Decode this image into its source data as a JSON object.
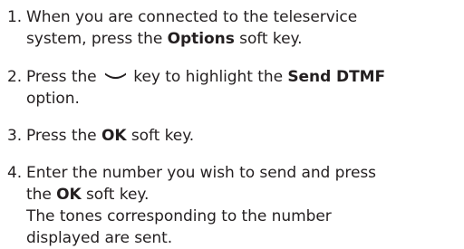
{
  "steps": [
    {
      "number": "1.",
      "line1": "When you are connected to the teleservice",
      "line2_pre": "system, press the ",
      "line2_bold": "Options",
      "line2_post": " soft key."
    },
    {
      "number": "2.",
      "line1_pre": "Press the ",
      "key_icon": "down-navigation-key-icon",
      "line1_mid": " key to highlight the ",
      "line1_bold": "Send DTMF",
      "line2": "option."
    },
    {
      "number": "3.",
      "line1_pre": "Press the ",
      "line1_bold": "OK",
      "line1_post": " soft key."
    },
    {
      "number": "4.",
      "line1": "Enter the number you wish to send and press",
      "line2_pre": "the ",
      "line2_bold": "OK",
      "line2_post": " soft key.",
      "line3": "The tones corresponding to the number",
      "line4": "displayed are sent."
    }
  ]
}
